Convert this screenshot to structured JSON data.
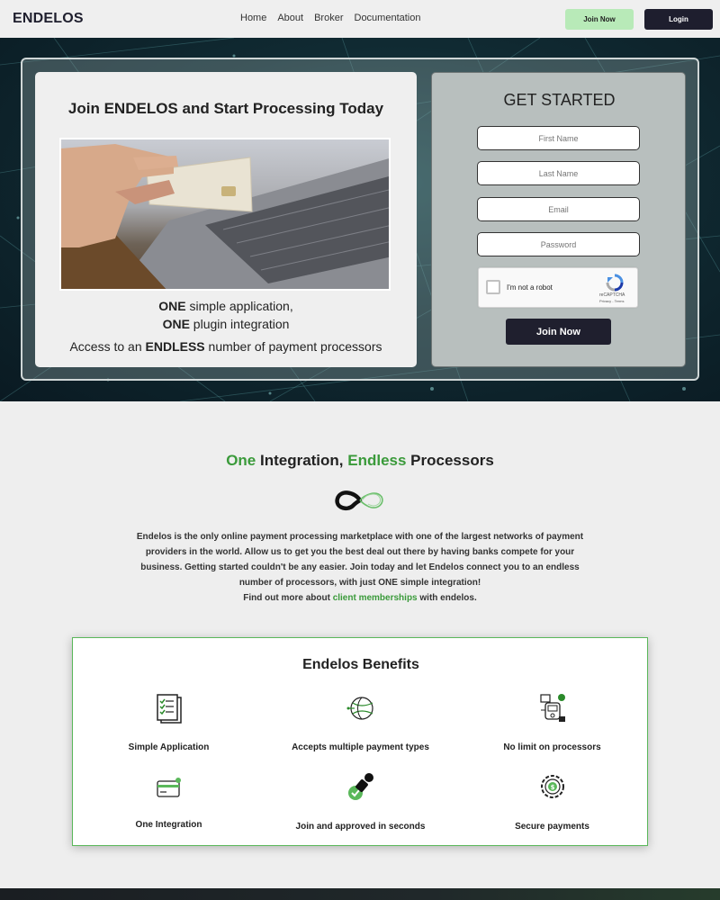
{
  "nav": {
    "brand": "ENDELOS",
    "links": [
      "Home",
      "About",
      "Broker",
      "Documentation"
    ],
    "join_label": "Join Now",
    "login_label": "Login"
  },
  "hero": {
    "title": "Join ENDELOS and Start Processing Today",
    "tagline_1_bold": "ONE",
    "tagline_1_rest": " simple application,",
    "tagline_2_bold": "ONE",
    "tagline_2_rest": " plugin integration",
    "tagline_3_pre": "Access to an ",
    "tagline_3_bold": "ENDLESS",
    "tagline_3_post": " number of payment processors"
  },
  "signup": {
    "title": "GET STARTED",
    "first_name_placeholder": "First Name",
    "last_name_placeholder": "Last Name",
    "email_placeholder": "Email",
    "password_placeholder": "Password",
    "captcha_label": "I'm not a robot",
    "captcha_brand": "reCAPTCHA",
    "captcha_terms": "Privacy - Terms",
    "submit_label": "Join Now"
  },
  "integration": {
    "title_one": "One",
    "title_mid": " Integration, ",
    "title_endless": "Endless",
    "title_end": " Processors",
    "para_1": "Endelos is the only online payment processing marketplace with one of the largest networks of payment providers in the world. Allow us to get you the best deal out there by having banks compete for your business. Getting started couldn't be any easier. Join today and let Endelos connect you to an endless number of processors, with just ",
    "para_bold": "ONE",
    "para_2": " simple integration!",
    "more_pre": "Find out more about ",
    "more_link": "client memberships",
    "more_post": " with endelos."
  },
  "benefits": {
    "title": "Endelos Benefits",
    "items": [
      {
        "label": "Simple Application",
        "icon": "checklist-icon"
      },
      {
        "label": "Accepts multiple payment types",
        "icon": "globe-network-icon"
      },
      {
        "label": "No limit on processors",
        "icon": "payment-terminal-icon"
      },
      {
        "label": "One Integration",
        "icon": "credit-card-icon"
      },
      {
        "label": "Join and approved in seconds",
        "icon": "stamp-approved-icon"
      },
      {
        "label": "Secure payments",
        "icon": "secure-gear-dollar-icon"
      }
    ]
  },
  "colors": {
    "accent_green": "#3a9a3a",
    "dark_button": "#1f1f2e",
    "join_button_light": "#b8eab8"
  }
}
